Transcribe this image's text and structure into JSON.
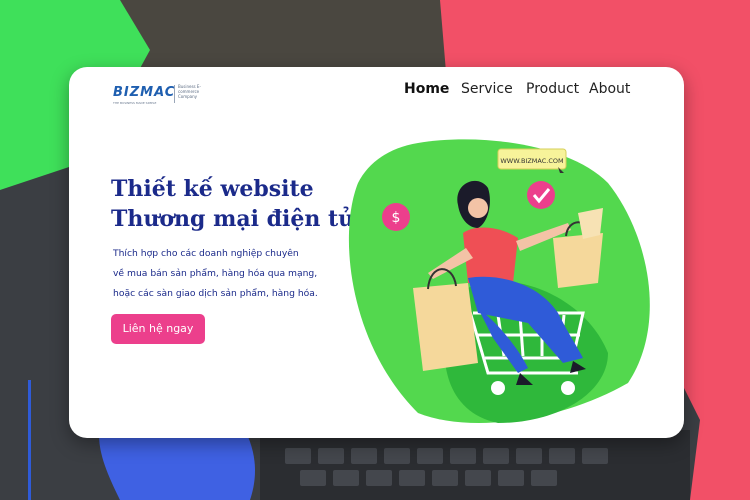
{
  "brand": {
    "logo_text": "BIZMAC",
    "logo_subtext": "THE BUSINESS MADE SIMPLE",
    "tagline": "Business E-commerce Company"
  },
  "nav": {
    "items": [
      {
        "label": "Home",
        "active": true
      },
      {
        "label": "Service",
        "active": false
      },
      {
        "label": "Product",
        "active": false
      },
      {
        "label": "About",
        "active": false
      }
    ]
  },
  "hero": {
    "title_line1": "Thiết kế website",
    "title_line2": "Thương mại điện tử",
    "desc_lines": [
      "Thích hợp cho các doanh nghiệp chuyên",
      "về mua bán sản phẩm, hàng hóa qua mạng,",
      "hoặc các sàn giao dịch sản phẩm, hàng hóa."
    ],
    "cta_label": "Liên hệ ngay"
  },
  "illustration": {
    "sign_text": "WWW.BIZMAC.COM",
    "coin_symbol": "$"
  },
  "colors": {
    "brand_blue": "#1b2a8a",
    "accent_pink": "#ec3f8c",
    "accent_green": "#4fd64c",
    "bg_coral": "#f25067"
  }
}
